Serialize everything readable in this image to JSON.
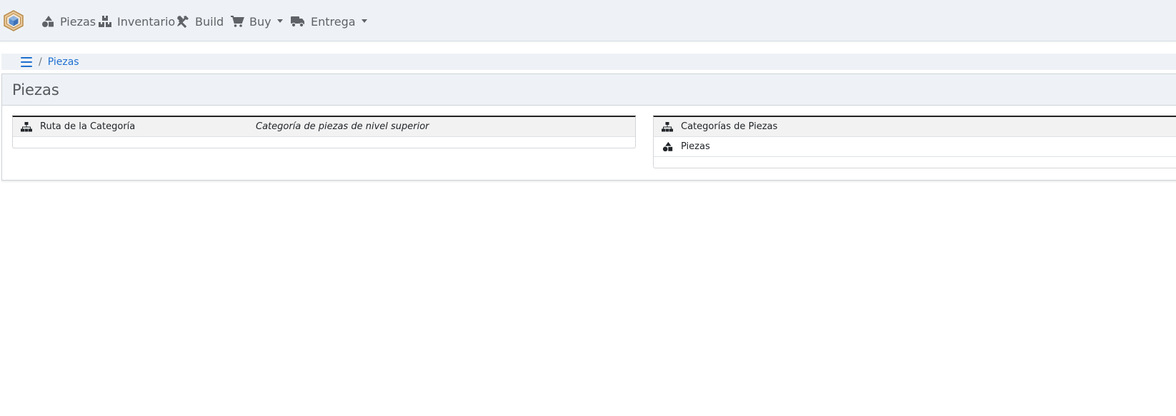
{
  "navbar": {
    "brand_icon": "inventree-logo-icon",
    "items": [
      {
        "label": "Piezas",
        "icon": "shapes-icon",
        "dropdown": false
      },
      {
        "label": "Inventario",
        "icon": "boxes-icon",
        "dropdown": false
      },
      {
        "label": "Build",
        "icon": "tools-icon",
        "dropdown": false
      },
      {
        "label": "Buy",
        "icon": "shopping-cart-icon",
        "dropdown": true
      },
      {
        "label": "Entrega",
        "icon": "truck-icon",
        "dropdown": true
      }
    ]
  },
  "breadcrumb": {
    "menu_icon": "bars-icon",
    "separator": "/",
    "current": "Piezas"
  },
  "panel": {
    "title": "Piezas"
  },
  "details_table": {
    "rows": [
      {
        "icon": "sitemap-icon",
        "label": "Ruta de la Categoría",
        "value": "Categoría de piezas de nivel superior"
      }
    ]
  },
  "stats_table": {
    "rows": [
      {
        "icon": "sitemap-icon",
        "label": "Categorías de Piezas"
      },
      {
        "icon": "shapes-icon",
        "label": "Piezas"
      }
    ]
  },
  "colors": {
    "navbar_bg": "#eef2f6",
    "link": "#1e6fd0",
    "nav_text": "#5f6368"
  }
}
